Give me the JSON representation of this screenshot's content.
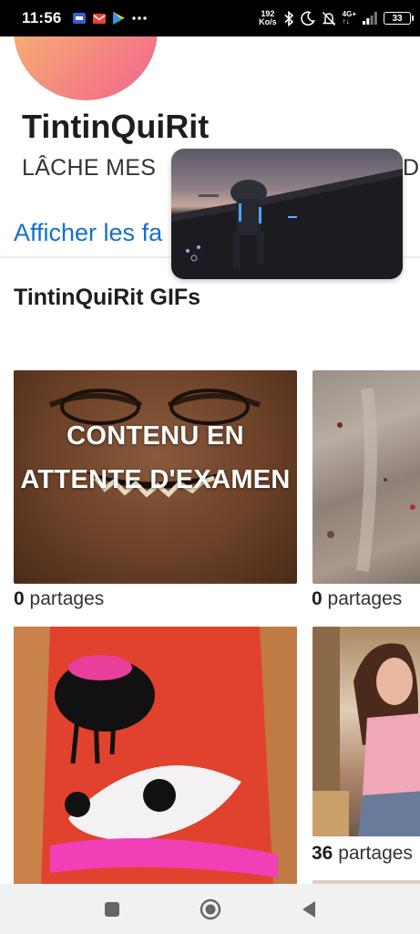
{
  "status_bar": {
    "time": "11:56",
    "net_speed_value": "192",
    "net_speed_unit": "Ko/s",
    "network_type": "4G+",
    "battery": "33"
  },
  "profile": {
    "name": "TintinQuiRit",
    "bio": "LÂCHE MES",
    "bio_tail": "DI",
    "favorites_link": "Afficher les fa"
  },
  "gifs_section": {
    "title": "TintinQuiRit GIFs"
  },
  "gifs": [
    {
      "pending_label": "CONTENU EN ATTENTE D'EXAMEN",
      "shares_count": "0",
      "shares_label": "partages"
    },
    {
      "shares_count": "0",
      "shares_label": "partages"
    },
    {
      "shares_count": "",
      "shares_label": ""
    },
    {
      "shares_count": "36",
      "shares_label": "partages"
    }
  ],
  "colors": {
    "link": "#1670c8",
    "avatar_gradient_start": "#f7c66b",
    "avatar_gradient_end": "#f2628f",
    "status_bar_bg": "#000000",
    "nav_bar_bg": "#f1f1f1"
  },
  "icons": {
    "nav_recent": "square-icon",
    "nav_home": "circle-home-icon",
    "nav_back": "triangle-back-icon"
  }
}
